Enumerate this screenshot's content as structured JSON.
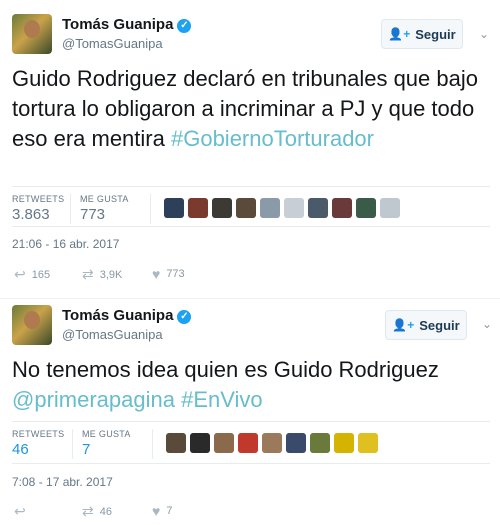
{
  "tweets": [
    {
      "name": "Tomás Guanipa",
      "handle": "@TomasGuanipa",
      "follow_label": "Seguir",
      "text_plain": "Guido Rodriguez declaró en tribunales que bajo tortura lo obligaron a incriminar a PJ y que todo eso era mentira",
      "hashtag": "#GobiernoTorturador",
      "retweets_label": "RETWEETS",
      "retweets_value": "3.863",
      "likes_label": "ME GUSTA",
      "likes_value": "773",
      "timestamp": "21:06 - 16 abr. 2017",
      "reply_count": "165",
      "retweet_count": "3,9K",
      "like_count": "773",
      "face_colors": [
        "#2e3f5a",
        "#7a3b2e",
        "#3d3a35",
        "#5a4a3a",
        "#8a9aa8",
        "#c7ced6",
        "#4a5a6a",
        "#6a3a3a",
        "#3a5a4a",
        "#bfc7cf"
      ]
    },
    {
      "name": "Tomás Guanipa",
      "handle": "@TomasGuanipa",
      "follow_label": "Seguir",
      "text_plain": "No tenemos idea quien es Guido Rodriguez",
      "mention": "@primerapagina",
      "hashtag": "#EnVivo",
      "retweets_label": "RETWEETS",
      "retweets_value": "46",
      "likes_label": "ME GUSTA",
      "likes_value": "7",
      "timestamp": "7:08 - 17 abr. 2017",
      "reply_count": "",
      "retweet_count": "46",
      "like_count": "7",
      "face_colors": [
        "#5a4a3a",
        "#2a2a2a",
        "#8a6a4a",
        "#c0392b",
        "#9a7a5a",
        "#3a4a6a",
        "#6a7a3a",
        "#d4b400",
        "#e0c020"
      ]
    }
  ]
}
